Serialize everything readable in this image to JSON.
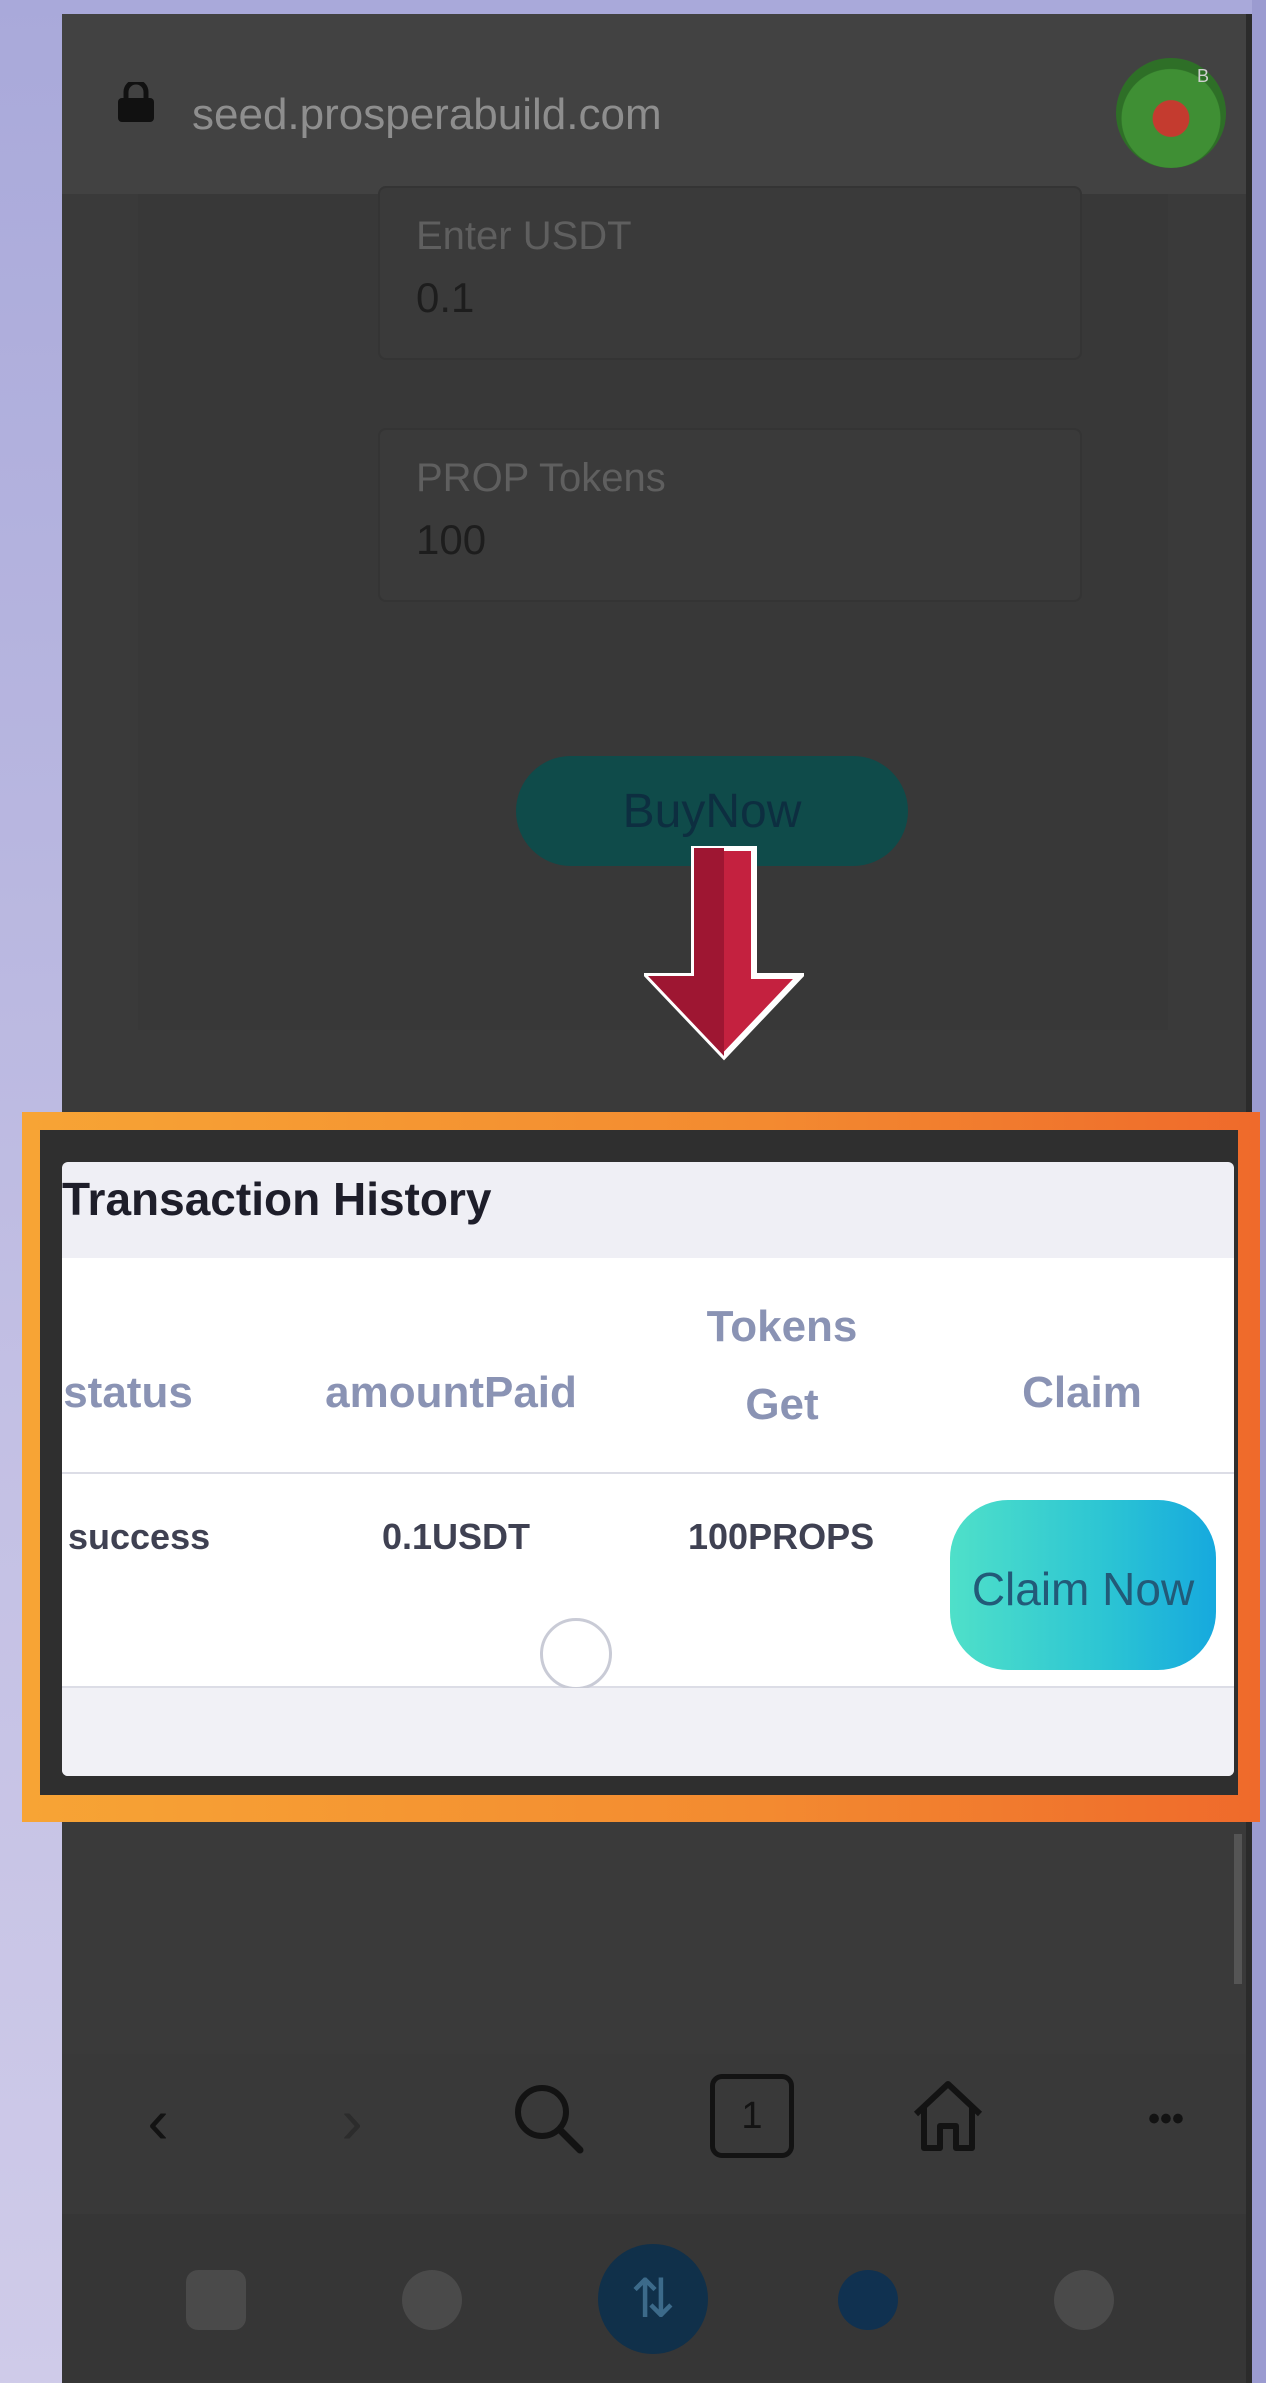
{
  "browser": {
    "url": "seed.prosperabuild.com",
    "avatar_badge": "B",
    "lock_icon": "lock-icon"
  },
  "form": {
    "usdt_label": "Enter USDT",
    "usdt_value": "0.1",
    "prop_label": "PROP Tokens",
    "prop_value": "100",
    "buy_label": "BuyNow"
  },
  "transaction_history": {
    "title": "Transaction History",
    "columns": [
      "status",
      "amountPaid",
      "Tokens Get",
      "Claim"
    ],
    "rows": [
      {
        "status": "success",
        "amountPaid": "0.1USDT",
        "tokens": "100PROPS",
        "claim_label": "Claim Now"
      }
    ]
  },
  "navbar": {
    "back": "‹",
    "forward": "›",
    "search_icon": "search-icon",
    "tab_count": "1",
    "home_icon": "home-icon",
    "more": "•••"
  },
  "colors": {
    "frame_orange": "#f38a30",
    "arrow_red": "#c4213f",
    "claim_teal": "#2bc4d4"
  }
}
